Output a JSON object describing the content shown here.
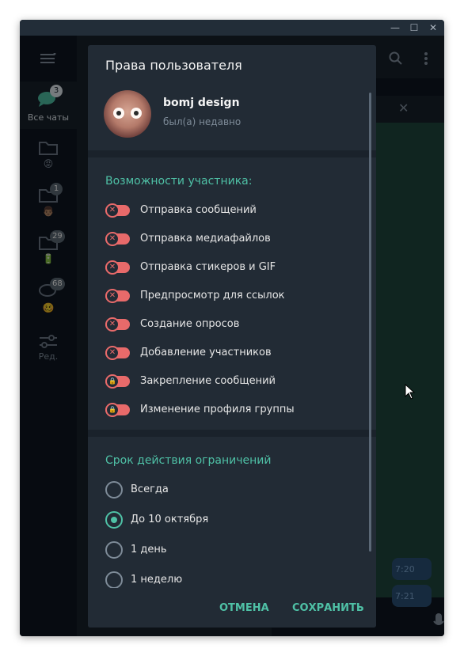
{
  "window": {
    "controls": [
      "—",
      "☐",
      "✕"
    ]
  },
  "folders": [
    {
      "label": "Все чаты",
      "badge": "3",
      "icon": "chat-bubbles-icon",
      "emoji": ""
    },
    {
      "label": "",
      "badge": "",
      "icon": "folder-icon",
      "emoji": "😡"
    },
    {
      "label": "",
      "badge": "1",
      "icon": "folder-icon",
      "emoji": "👨🏽"
    },
    {
      "label": "",
      "badge": "29",
      "icon": "folder-icon",
      "emoji": "🔋"
    },
    {
      "label": "",
      "badge": "68",
      "icon": "chat-icon",
      "emoji": "🥴"
    },
    {
      "label": "Ред.",
      "badge": "",
      "icon": "edit-filters-icon",
      "emoji": ""
    }
  ],
  "chat": {
    "header_tail": "...",
    "times": [
      "7:20",
      "7:21"
    ]
  },
  "dialog": {
    "title": "Права пользователя",
    "user": {
      "name": "bomj design",
      "status": "был(а) недавно"
    },
    "permissions_header": "Возможности участника:",
    "permissions": [
      {
        "label": "Отправка сообщений",
        "state": "off",
        "icon": "x-icon"
      },
      {
        "label": "Отправка медиафайлов",
        "state": "off",
        "icon": "x-icon"
      },
      {
        "label": "Отправка стикеров и GIF",
        "state": "off",
        "icon": "x-icon"
      },
      {
        "label": "Предпросмотр для ссылок",
        "state": "off",
        "icon": "x-icon"
      },
      {
        "label": "Создание опросов",
        "state": "off",
        "icon": "x-icon"
      },
      {
        "label": "Добавление участников",
        "state": "off",
        "icon": "x-icon"
      },
      {
        "label": "Закрепление сообщений",
        "state": "locked",
        "icon": "lock-icon"
      },
      {
        "label": "Изменение профиля группы",
        "state": "locked",
        "icon": "lock-icon"
      }
    ],
    "duration_header": "Срок действия ограничений",
    "durations": [
      {
        "label": "Всегда",
        "selected": false
      },
      {
        "label": "До 10 октября",
        "selected": true
      },
      {
        "label": "1 день",
        "selected": false
      },
      {
        "label": "1 неделю",
        "selected": false
      }
    ],
    "cancel_label": "ОТМЕНА",
    "save_label": "СОХРАНИТЬ"
  },
  "colors": {
    "accent": "#4fc1a6",
    "restricted": "#e86a6a",
    "dialog_bg": "#222b35"
  }
}
